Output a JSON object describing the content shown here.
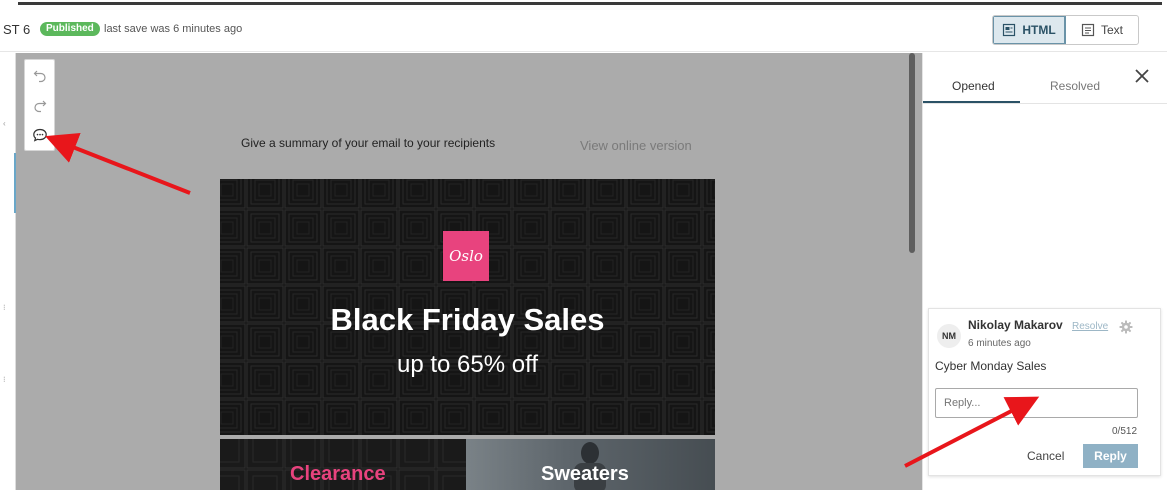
{
  "header": {
    "title": "ST 6",
    "status_badge": "Published",
    "save_text": "last save was 6 minutes ago",
    "modes": [
      {
        "label": "HTML",
        "active": true
      },
      {
        "label": "Text",
        "active": false
      }
    ]
  },
  "toolbox": {
    "icons": [
      "undo-icon",
      "redo-icon",
      "comment-icon"
    ]
  },
  "email": {
    "summary": "Give a summary of your email to your recipients",
    "view_online": "View online version",
    "logo_text": "Oslo",
    "hero_title": "Black Friday Sales",
    "hero_subtitle": "up to 65% off",
    "tiles": [
      "Clearance",
      "Sweaters"
    ]
  },
  "comments_panel": {
    "tabs": [
      {
        "label": "Opened",
        "active": true
      },
      {
        "label": "Resolved",
        "active": false
      }
    ],
    "comment": {
      "initials": "NM",
      "author": "Nikolay Makarov",
      "time": "6 minutes ago",
      "resolve_label": "Resolve",
      "text": "Cyber Monday Sales",
      "reply_placeholder": "Reply...",
      "counter": "0/512",
      "cancel_label": "Cancel",
      "reply_label": "Reply"
    }
  },
  "colors": {
    "published_green": "#5cb85c",
    "brand_pink": "#e8437e",
    "accent_blue": "#2b5266",
    "annotation_red": "#e8161b"
  }
}
